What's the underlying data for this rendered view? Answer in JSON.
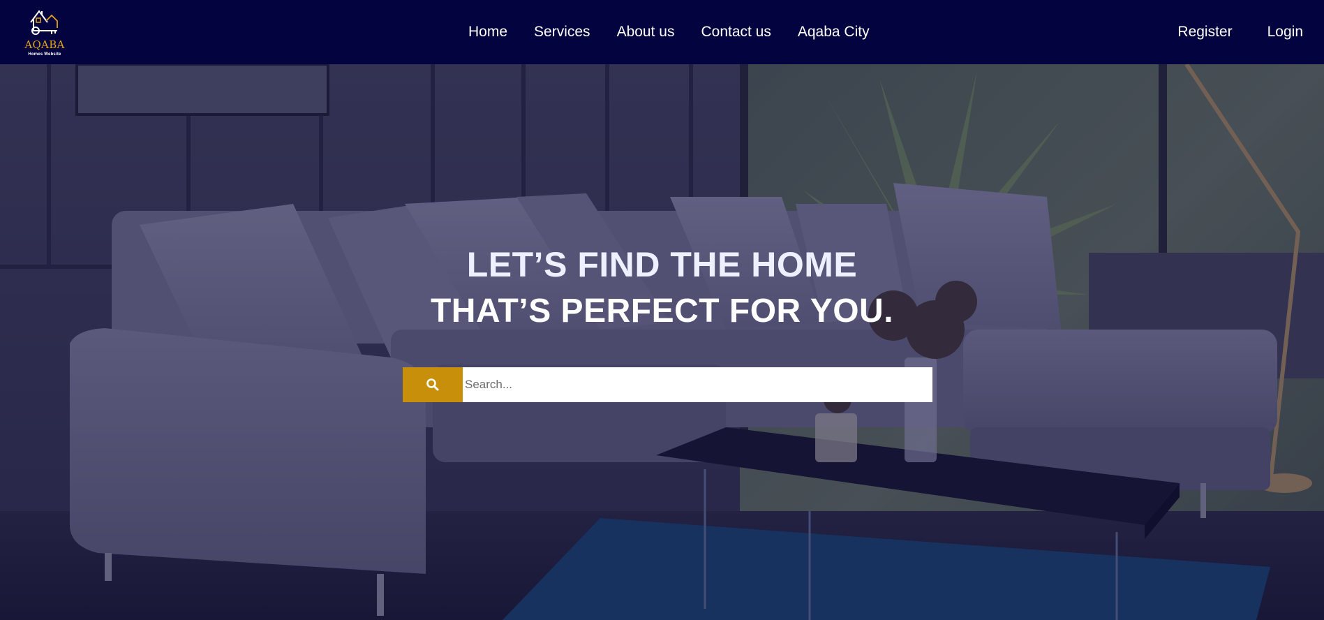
{
  "brand": {
    "name": "AQABA",
    "tagline": "Homes Website",
    "accent": "#e6a31d"
  },
  "nav": {
    "links": [
      "Home",
      "Services",
      "About us",
      "Contact us",
      "Aqaba City"
    ],
    "register": "Register",
    "login": "Login",
    "background": "#03033f"
  },
  "hero": {
    "title": "LET’S FIND THE HOME",
    "subtitle": "THAT’S PERFECT FOR YOU.",
    "search": {
      "placeholder": "Search...",
      "button_icon": "search-icon",
      "button_color": "#c8900a"
    }
  }
}
